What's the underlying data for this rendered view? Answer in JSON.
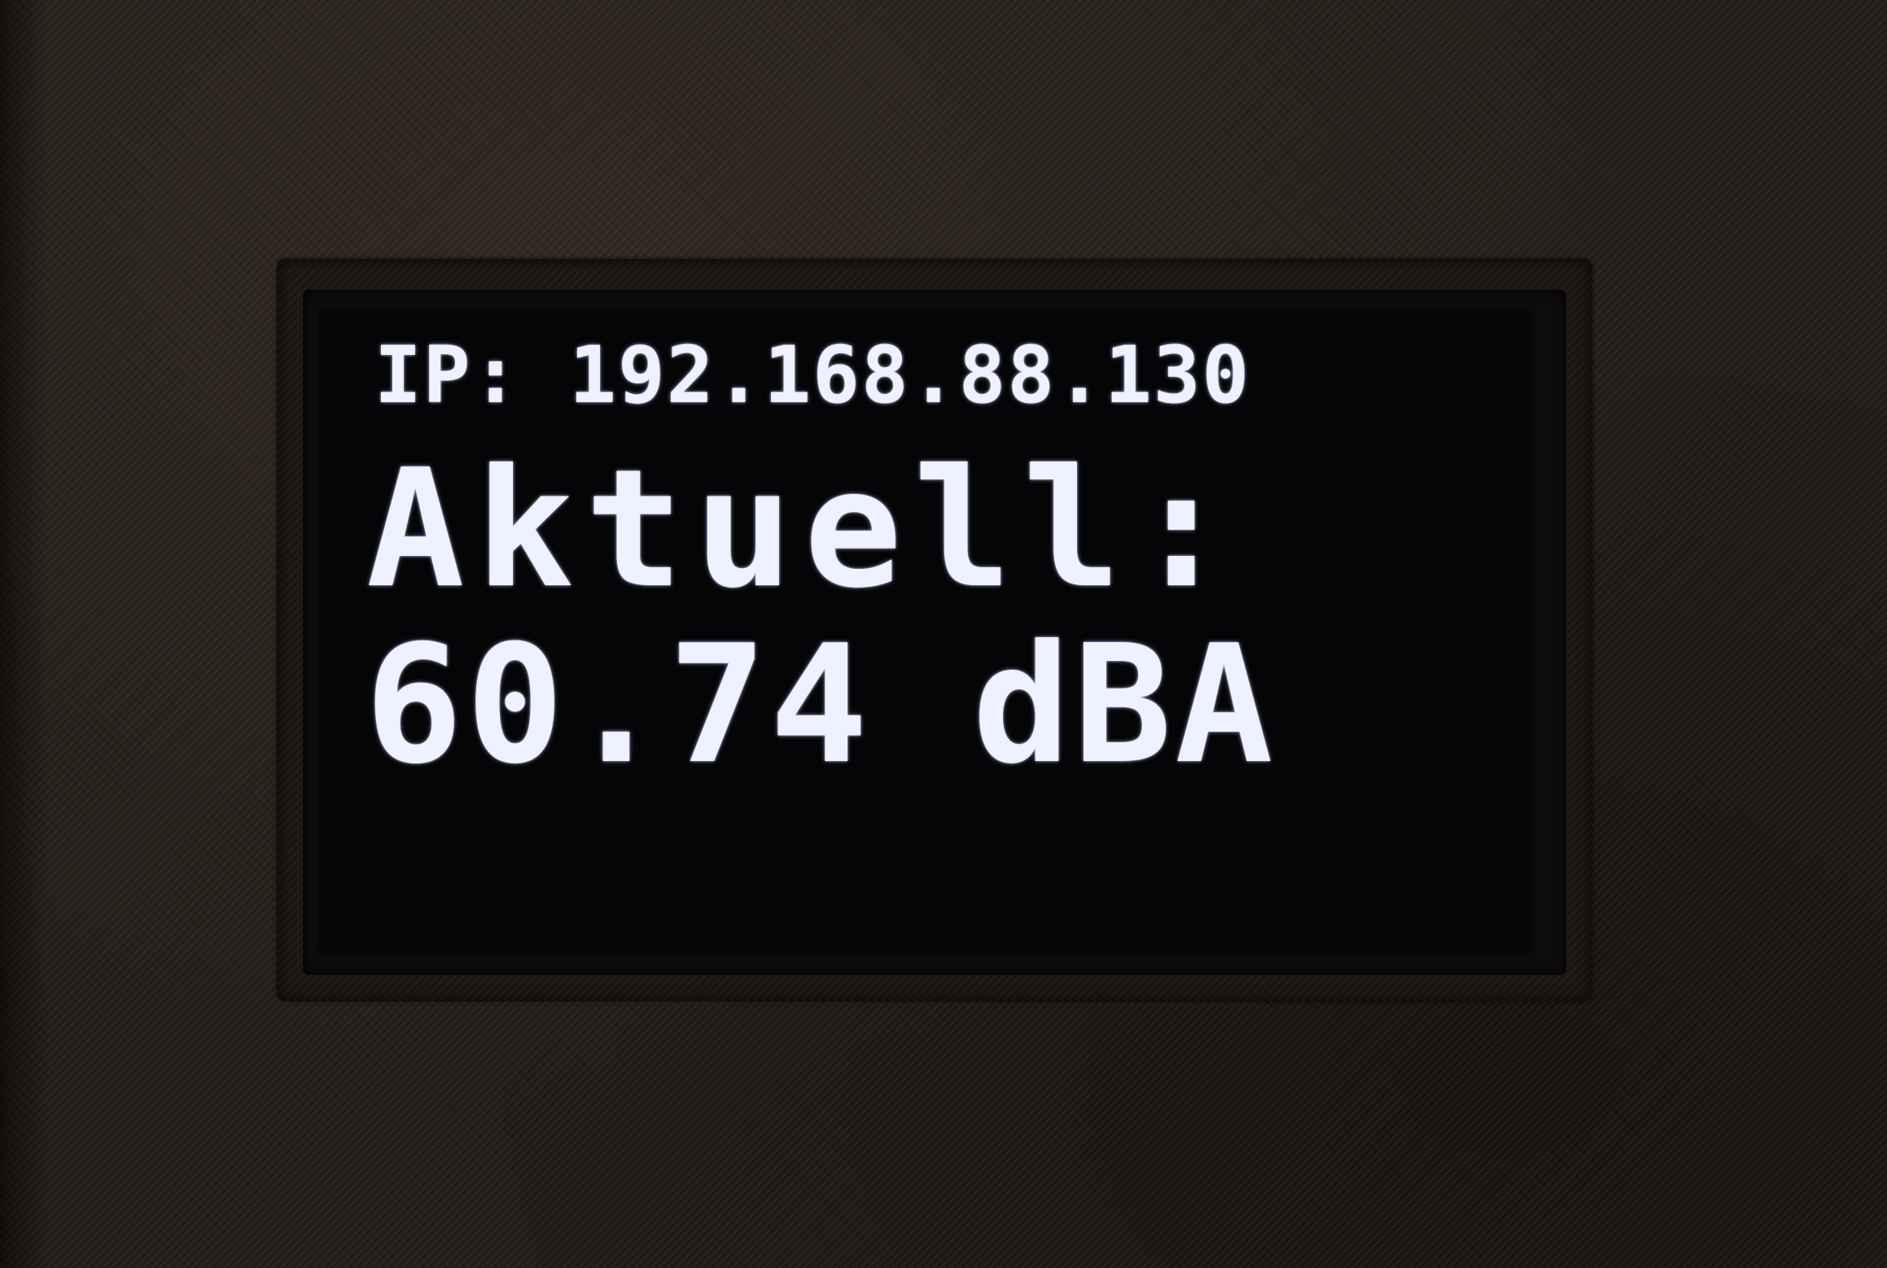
{
  "display": {
    "ip_line": "IP: 192.168.88.130",
    "label_line": "Aktuell:",
    "value_line": "60.74 dBA"
  },
  "reading": {
    "level": 60.74,
    "unit": "dBA"
  },
  "colors": {
    "enclosure": "#241e19",
    "screen_background": "#050508",
    "pixel_text": "#eef1ff"
  }
}
